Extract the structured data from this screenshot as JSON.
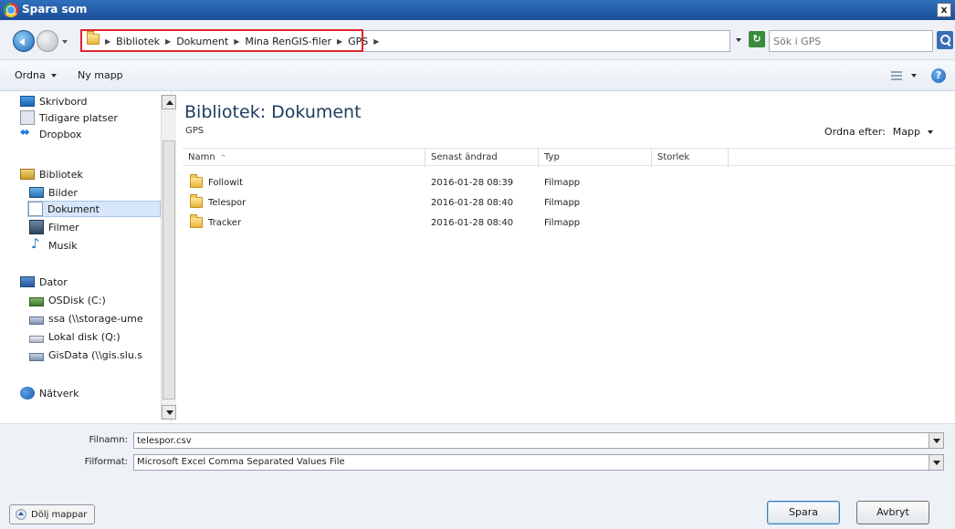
{
  "window": {
    "title": "Spara som",
    "close_label": "x"
  },
  "address": {
    "crumbs": [
      "Bibliotek",
      "Dokument",
      "Mina RenGIS-filer",
      "GPS"
    ],
    "search_placeholder": "Sök i GPS"
  },
  "toolbar": {
    "organize_label": "Ordna",
    "new_folder_label": "Ny mapp",
    "help_label": "?"
  },
  "nav": {
    "favorites": [
      "Skrivbord",
      "Tidigare platser",
      "Dropbox"
    ],
    "libraries_header": "Bibliotek",
    "libraries": [
      "Bilder",
      "Dokument",
      "Filmer",
      "Musik"
    ],
    "computer_header": "Dator",
    "drives": [
      "OSDisk (C:)",
      "ssa (\\\\storage-ume",
      "Lokal disk (Q:)",
      "GisData (\\\\gis.slu.s"
    ],
    "network": "Nätverk",
    "selected": "Dokument"
  },
  "content": {
    "title": "Bibliotek: Dokument",
    "subtitle": "GPS",
    "arrange_label": "Ordna efter:",
    "arrange_value": "Mapp",
    "columns": [
      "Namn",
      "Senast ändrad",
      "Typ",
      "Storlek"
    ],
    "sort_indicator": "^",
    "files": [
      {
        "name": "Followit",
        "modified": "2016-01-28 08:39",
        "type": "Filmapp",
        "size": ""
      },
      {
        "name": "Telespor",
        "modified": "2016-01-28 08:40",
        "type": "Filmapp",
        "size": ""
      },
      {
        "name": "Tracker",
        "modified": "2016-01-28 08:40",
        "type": "Filmapp",
        "size": ""
      }
    ]
  },
  "bottom": {
    "filename_label": "Filnamn:",
    "filename_value": "telespor.csv",
    "format_label": "Filformat:",
    "format_value": "Microsoft Excel Comma Separated Values File",
    "hide_folders_label": "Dölj mappar",
    "save_label": "Spara",
    "cancel_label": "Avbryt"
  },
  "colors": {
    "accent": "#1d4f96",
    "highlight": "#e0232e",
    "selected_bg": "#d7e6f8"
  }
}
